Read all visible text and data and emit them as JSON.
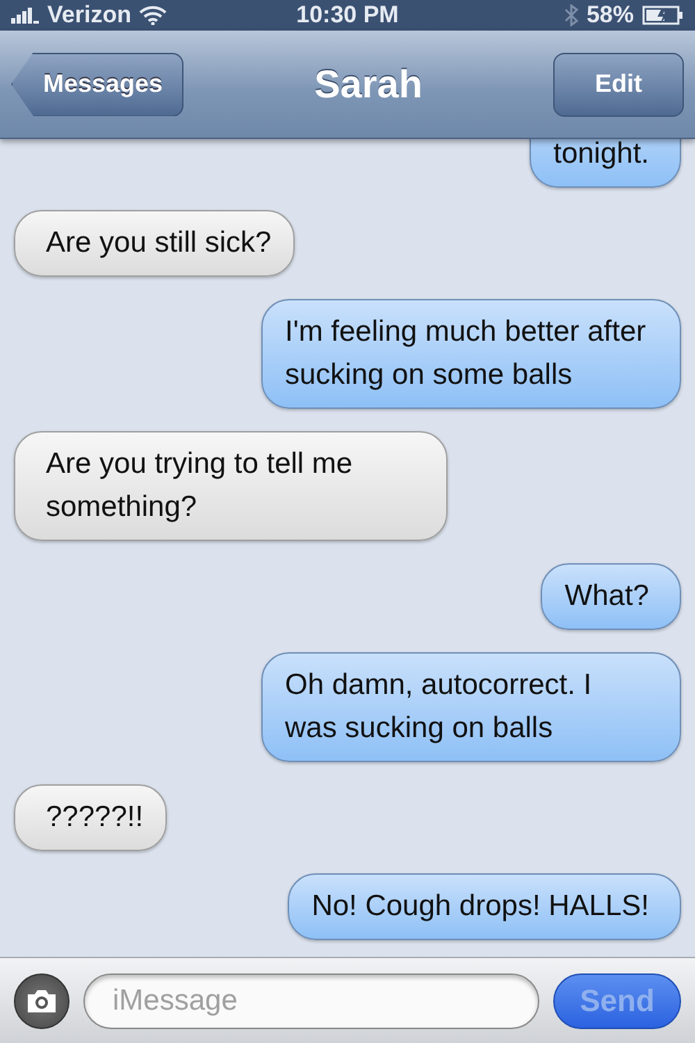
{
  "status_bar": {
    "carrier": "Verizon",
    "time": "10:30 PM",
    "battery": "58%"
  },
  "nav": {
    "back": "Messages",
    "title": "Sarah",
    "action": "Edit"
  },
  "messages": [
    {
      "kind": "sent",
      "text": "tonight."
    },
    {
      "kind": "received",
      "text": "Are you still sick?"
    },
    {
      "kind": "sent",
      "text": "I'm feeling much better after sucking on some balls"
    },
    {
      "kind": "received",
      "text": "Are you trying to tell me something?"
    },
    {
      "kind": "sent",
      "text": "What?"
    },
    {
      "kind": "sent",
      "text": "Oh damn, autocorrect. I was sucking on balls"
    },
    {
      "kind": "received",
      "text": "?????!!"
    },
    {
      "kind": "sent",
      "text": "No! Cough drops! HALLS!"
    }
  ],
  "composer": {
    "placeholder": "iMessage",
    "send": {
      "label": "Send",
      "disabled": true
    }
  }
}
